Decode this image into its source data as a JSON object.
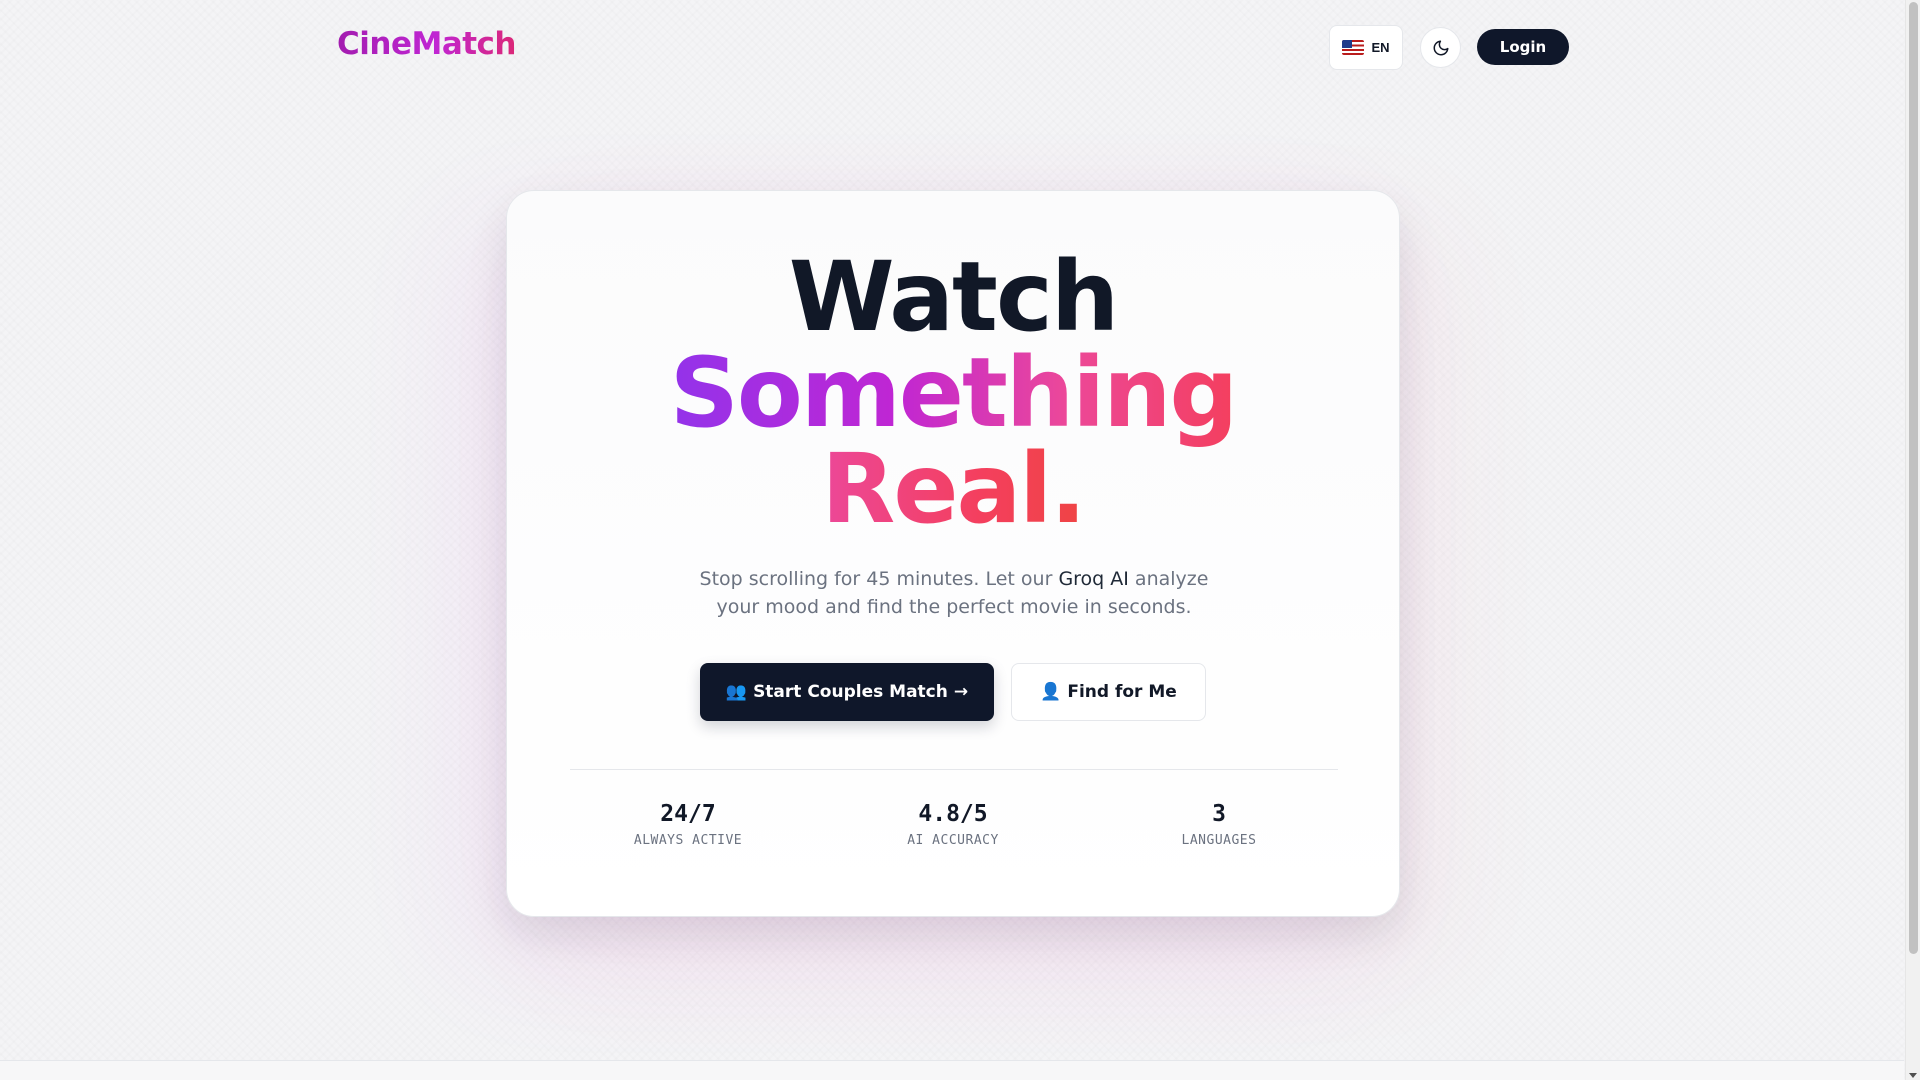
{
  "header": {
    "logo": "CineMatch",
    "language": {
      "flag_icon": "us-flag-icon",
      "code": "EN"
    },
    "theme_icon": "moon-icon",
    "login_label": "Login"
  },
  "hero": {
    "headline_line1": "Watch",
    "headline_line2": "Something",
    "headline_line3": "Real.",
    "subtitle_before": "Stop scrolling for 45 minutes. Let our ",
    "subtitle_highlight": "Groq AI",
    "subtitle_after": " analyze your mood and find the perfect movie in seconds.",
    "primary_cta": {
      "icon": "👥",
      "label": "Start Couples Match",
      "arrow": "→"
    },
    "secondary_cta": {
      "icon": "👤",
      "label": "Find for Me"
    }
  },
  "stats": [
    {
      "value": "24/7",
      "label": "ALWAYS ACTIVE"
    },
    {
      "value": "4.8/5",
      "label": "AI ACCURACY"
    },
    {
      "value": "3",
      "label": "LANGUAGES"
    }
  ],
  "colors": {
    "dark": "#0f172a",
    "gradient_start": "#9333ea",
    "gradient_mid": "#ec4899",
    "gradient_end": "#f43f5e"
  }
}
